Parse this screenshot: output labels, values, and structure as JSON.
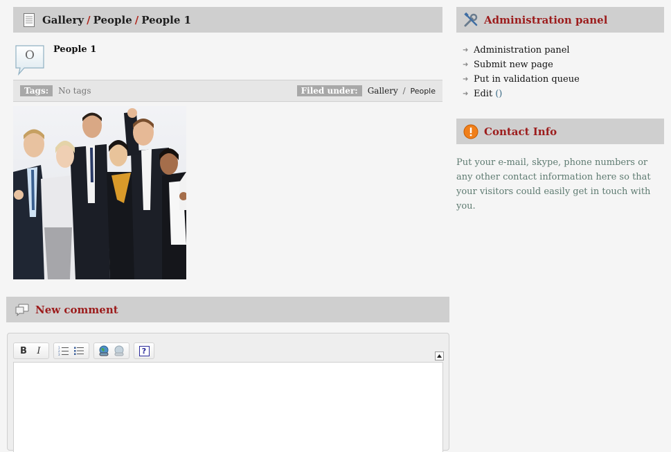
{
  "breadcrumb": {
    "items": [
      "Gallery",
      "People",
      "People 1"
    ],
    "separator": "/"
  },
  "post": {
    "avatar_letter": "O",
    "title": "People 1",
    "tags_label": "Tags:",
    "tags_value": "No tags",
    "filed_label": "Filed under:",
    "filed_items": [
      "Gallery",
      "People"
    ],
    "filed_separator": "/"
  },
  "comment": {
    "title": "New comment",
    "toolbar": {
      "bold": "B",
      "italic": "I",
      "help": "?"
    }
  },
  "admin_panel": {
    "title": "Administration panel",
    "links": [
      "Administration panel",
      "Submit new page",
      "Put in validation queue",
      "Edit"
    ],
    "edit_suffix": "()"
  },
  "contact": {
    "title": "Contact Info",
    "text": "Put your e-mail, skype, phone numbers or any other contact information here so that your visitors could easily get in touch with you."
  },
  "colors": {
    "header_bar": "#cfcfcf",
    "accent_red": "#9c1c1c",
    "separator_red": "#b0261c",
    "contact_text": "#5d7a70"
  }
}
